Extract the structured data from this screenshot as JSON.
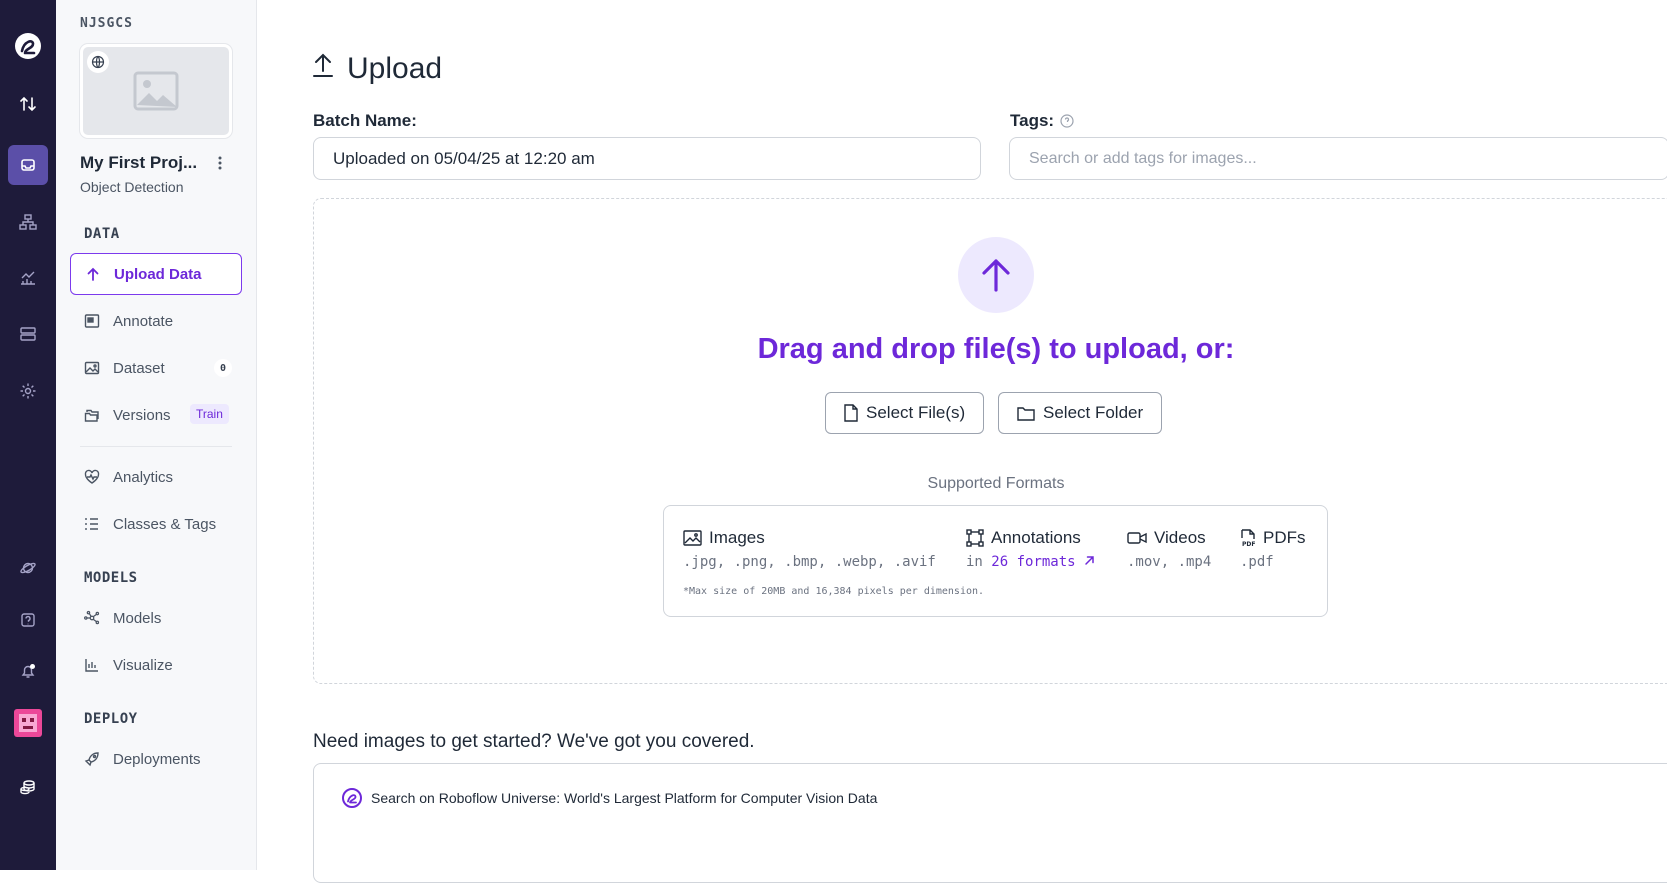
{
  "rail": {
    "items": [
      {
        "name": "logo-icon"
      },
      {
        "name": "sort-arrows-icon"
      },
      {
        "name": "inbox-icon",
        "active": true
      },
      {
        "name": "workflow-icon"
      },
      {
        "name": "chart-icon"
      },
      {
        "name": "server-icon"
      },
      {
        "name": "gear-icon"
      },
      {
        "name": "planet-icon"
      },
      {
        "name": "help-icon"
      },
      {
        "name": "bell-icon"
      },
      {
        "name": "avatar-icon"
      },
      {
        "name": "coins-icon"
      }
    ]
  },
  "sidebar": {
    "workspace": "NJSGCS",
    "project_name": "My First Proj...",
    "project_type": "Object Detection",
    "sections": {
      "data": "DATA",
      "models": "MODELS",
      "deploy": "DEPLOY"
    },
    "nav": {
      "upload": "Upload Data",
      "annotate": "Annotate",
      "dataset": "Dataset",
      "dataset_count": "0",
      "versions": "Versions",
      "versions_badge": "Train",
      "analytics": "Analytics",
      "classes": "Classes & Tags",
      "models": "Models",
      "visualize": "Visualize",
      "deployments": "Deployments"
    }
  },
  "main": {
    "title": "Upload",
    "batch_label": "Batch Name:",
    "batch_value": "Uploaded on 05/04/25 at 12:20 am",
    "tags_label": "Tags:",
    "tags_placeholder": "Search or add tags for images...",
    "drop_text": "Drag and drop file(s) to upload, or:",
    "select_files": "Select File(s)",
    "select_folder": "Select Folder",
    "supported_title": "Supported Formats",
    "formats": {
      "images": {
        "label": "Images",
        "ext": ".jpg, .png, .bmp, .webp, .avif"
      },
      "annotations": {
        "label": "Annotations",
        "prefix": "in ",
        "link": "26 formats"
      },
      "videos": {
        "label": "Videos",
        "ext": ".mov, .mp4"
      },
      "pdfs": {
        "label": "PDFs",
        "ext": ".pdf"
      }
    },
    "max_size_note": "*Max size of 20MB and 16,384 pixels per dimension.",
    "need_images": "Need images to get started? We've got you covered.",
    "universe_text": "Search on Roboflow Universe: World's Largest Platform for Computer Vision Data"
  },
  "colors": {
    "accent": "#6d28d9",
    "rail_bg": "#1e1b3a",
    "rail_active": "#5b4fa8"
  }
}
